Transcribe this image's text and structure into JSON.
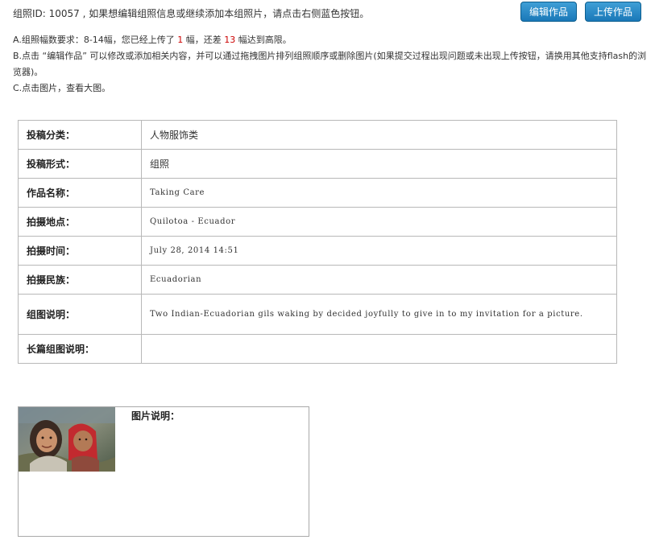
{
  "header": {
    "intro_text": "组照ID: 10057 , 如果想编辑组照信息或继续添加本组照片，请点击右侧蓝色按钮。",
    "edit_button": "编辑作品",
    "upload_button": "上传作品"
  },
  "instructions": {
    "a_prefix": "A.组照幅数要求：8-14幅，您已经上传了 ",
    "a_uploaded": "1",
    "a_middle": " 幅，还差 ",
    "a_remaining": "13",
    "a_suffix": " 幅达到高限。",
    "b_text": "B.点击 “编辑作品” 可以修改或添加相关内容，并可以通过拖拽图片排列组照顺序或删除图片(如果提交过程出现问题或未出现上传按钮，请换用其他支持flash的浏览器)。",
    "c_text": "C.点击图片，查看大图。"
  },
  "details": {
    "rows": [
      {
        "label": "投稿分类：",
        "value": "人物服饰类"
      },
      {
        "label": "投稿形式：",
        "value": "组照"
      },
      {
        "label": "作品名称：",
        "value": "Taking Care"
      },
      {
        "label": "拍摄地点：",
        "value": "Quilotoa - Ecuador"
      },
      {
        "label": "拍摄时间：",
        "value": "July 28, 2014 14:51"
      },
      {
        "label": "拍摄民族：",
        "value": "Ecuadorian"
      },
      {
        "label": "组图说明：",
        "value": "Two Indian-Ecuadorian gils waking by decided joyfully to give in to my invitation for a picture."
      },
      {
        "label": "长篇组图说明：",
        "value": ""
      }
    ]
  },
  "photo_card": {
    "label": "图片说明："
  }
}
